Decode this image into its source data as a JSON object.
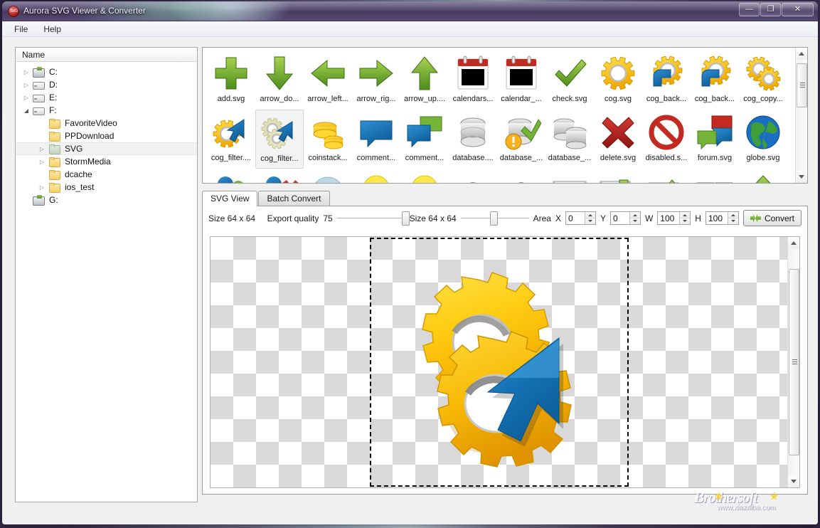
{
  "window": {
    "title": "Aurora SVG Viewer & Converter",
    "logo_text": "SVG",
    "minimize": "—",
    "maximize": "❐",
    "close": "✕"
  },
  "menu": {
    "items": [
      {
        "label": "File"
      },
      {
        "label": "Help"
      }
    ]
  },
  "tree": {
    "header": "Name",
    "items": [
      {
        "label": "C:",
        "icon": "hdd-icon",
        "twisty": "▷",
        "indent": 0,
        "selected": false
      },
      {
        "label": "D:",
        "icon": "drive-icon",
        "twisty": "▷",
        "indent": 0,
        "selected": false
      },
      {
        "label": "E:",
        "icon": "drive-icon",
        "twisty": "▷",
        "indent": 0,
        "selected": false
      },
      {
        "label": "F:",
        "icon": "drive-icon",
        "twisty": "◢",
        "indent": 0,
        "selected": false
      },
      {
        "label": "FavoriteVideo",
        "icon": "folder-icon",
        "twisty": "",
        "indent": 2,
        "selected": false
      },
      {
        "label": "PPDownload",
        "icon": "folder-icon",
        "twisty": "",
        "indent": 2,
        "selected": false
      },
      {
        "label": "SVG",
        "icon": "folder-open-icon",
        "twisty": "▷",
        "indent": 2,
        "selected": true
      },
      {
        "label": "StormMedia",
        "icon": "folder-icon",
        "twisty": "▷",
        "indent": 2,
        "selected": false
      },
      {
        "label": "dcache",
        "icon": "folder-icon",
        "twisty": "",
        "indent": 2,
        "selected": false
      },
      {
        "label": "ios_test",
        "icon": "folder-icon",
        "twisty": "▷",
        "indent": 2,
        "selected": false
      },
      {
        "label": "G:",
        "icon": "hdd-icon",
        "twisty": "",
        "indent": 0,
        "selected": false
      }
    ]
  },
  "gallery": {
    "rows": [
      [
        {
          "name": "add.svg",
          "art": "plus-green",
          "selected": false
        },
        {
          "name": "arrow_do...",
          "art": "arrow-down-green",
          "selected": false
        },
        {
          "name": "arrow_left...",
          "art": "arrow-left-green",
          "selected": false
        },
        {
          "name": "arrow_rig...",
          "art": "arrow-right-green",
          "selected": false
        },
        {
          "name": "arrow_up....",
          "art": "arrow-up-green",
          "selected": false
        },
        {
          "name": "calendars...",
          "art": "calendar",
          "selected": false
        },
        {
          "name": "calendar_...",
          "art": "calendar",
          "selected": false
        },
        {
          "name": "check.svg",
          "art": "check-green",
          "selected": false
        },
        {
          "name": "cog.svg",
          "art": "cog",
          "selected": false
        },
        {
          "name": "cog_back...",
          "art": "cog-back-blue",
          "selected": false
        },
        {
          "name": "cog_back...",
          "art": "cog-back-blue",
          "selected": false
        },
        {
          "name": "cog_copy...",
          "art": "cog-copy",
          "selected": false
        }
      ],
      [
        {
          "name": "cog_filter....",
          "art": "cog-filter-arrow",
          "selected": false
        },
        {
          "name": "cog_filter...",
          "art": "cog-filter-arrow-pale",
          "selected": true
        },
        {
          "name": "coinstack...",
          "art": "coinstack",
          "selected": false
        },
        {
          "name": "comment...",
          "art": "comment-blue",
          "selected": false
        },
        {
          "name": "comment...",
          "art": "comment-blue-green",
          "selected": false
        },
        {
          "name": "database....",
          "art": "database",
          "selected": false
        },
        {
          "name": "database_...",
          "art": "database-warn",
          "selected": false
        },
        {
          "name": "database_...",
          "art": "database-multi",
          "selected": false
        },
        {
          "name": "delete.svg",
          "art": "delete-x-red",
          "selected": false
        },
        {
          "name": "disabled.s...",
          "art": "disabled-red",
          "selected": false
        },
        {
          "name": "forum.svg",
          "art": "forum",
          "selected": false
        },
        {
          "name": "globe.svg",
          "art": "globe",
          "selected": false
        }
      ],
      [
        {
          "name": "",
          "art": "user-group",
          "selected": false
        },
        {
          "name": "",
          "art": "user-delete",
          "selected": false
        },
        {
          "name": "",
          "art": "user-disc",
          "selected": false
        },
        {
          "name": "",
          "art": "bulb-yellow",
          "selected": false
        },
        {
          "name": "",
          "art": "bulb-yellow",
          "selected": false
        },
        {
          "name": "",
          "art": "magnet",
          "selected": false
        },
        {
          "name": "",
          "art": "magnet",
          "selected": false
        },
        {
          "name": "",
          "art": "mail",
          "selected": false
        },
        {
          "name": "",
          "art": "mail-down",
          "selected": false
        },
        {
          "name": "",
          "art": "mail-up",
          "selected": false
        },
        {
          "name": "",
          "art": "monitor",
          "selected": false
        },
        {
          "name": "",
          "art": "upload-green",
          "selected": false
        }
      ]
    ]
  },
  "tabs": [
    {
      "label": "SVG View",
      "active": true
    },
    {
      "label": "Batch Convert",
      "active": false
    }
  ],
  "toolbar": {
    "size_label_left": "Size  64 x 64",
    "export_quality_label": "Export  quality",
    "export_quality_value": "75",
    "size_label_right": "Size  64 x 64",
    "area_label": "Area",
    "x_label": "X",
    "x_value": "0",
    "y_label": "Y",
    "y_value": "0",
    "w_label": "W",
    "w_value": "100",
    "h_label": "H",
    "h_value": "100",
    "convert_label": "Convert"
  },
  "watermark": {
    "title": "Brothersoft",
    "url": "www.xiazaiba.com"
  }
}
